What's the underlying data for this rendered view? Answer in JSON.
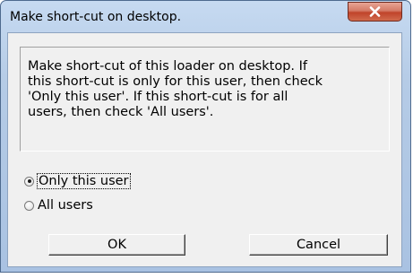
{
  "window": {
    "title": "Make short-cut on desktop.",
    "close_glyph": "✕"
  },
  "message": "Make short-cut of this loader on desktop. If\nthis short-cut is only for this user, then check\n'Only this user'. If this short-cut is for all\nusers, then check 'All users'.",
  "options": [
    {
      "label": "Only this user",
      "checked": true
    },
    {
      "label": "All users",
      "checked": false
    }
  ],
  "buttons": {
    "ok_label": "OK",
    "cancel_label": "Cancel"
  },
  "colors": {
    "close_button": "#c0432a",
    "frame": "#b5cbe6",
    "client": "#f0f0f0"
  }
}
